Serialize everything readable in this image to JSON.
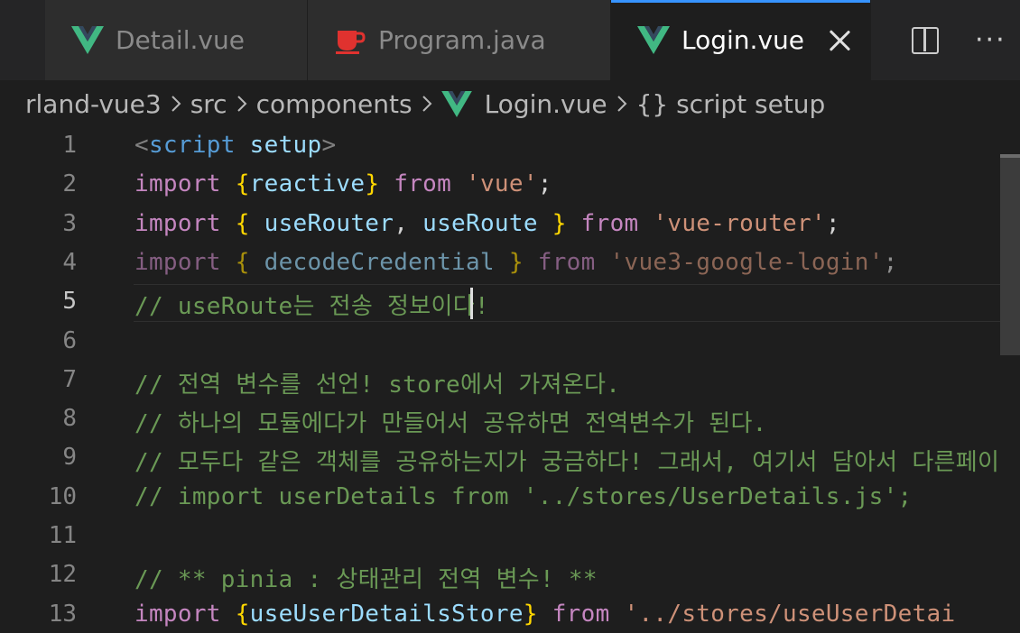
{
  "tabs": [
    {
      "label": "Detail.vue",
      "icon": "vue-icon",
      "active": false
    },
    {
      "label": "Program.java",
      "icon": "java-coffee-icon",
      "active": false
    },
    {
      "label": "Login.vue",
      "icon": "vue-icon",
      "active": true
    }
  ],
  "breadcrumb": {
    "items": [
      "rland-vue3",
      "src",
      "components",
      "Login.vue",
      "{} script setup"
    ]
  },
  "colors": {
    "vue_green": "#41b883",
    "vue_dark": "#34495e",
    "java_red": "#e0322f",
    "accent": "#3794ff"
  },
  "editor": {
    "current_line": 5,
    "lines": [
      {
        "no": "1",
        "tokens": [
          {
            "t": "<",
            "c": "t-punc"
          },
          {
            "t": "script",
            "c": "t-tag"
          },
          {
            "t": " ",
            "c": "t-plain"
          },
          {
            "t": "setup",
            "c": "t-attr"
          },
          {
            "t": ">",
            "c": "t-punc"
          }
        ]
      },
      {
        "no": "2",
        "tokens": [
          {
            "t": "import",
            "c": "t-kw"
          },
          {
            "t": " ",
            "c": "t-plain"
          },
          {
            "t": "{",
            "c": "t-brace"
          },
          {
            "t": "reactive",
            "c": "t-var"
          },
          {
            "t": "}",
            "c": "t-brace"
          },
          {
            "t": " from ",
            "c": "t-kw"
          },
          {
            "t": "'vue'",
            "c": "t-str"
          },
          {
            "t": ";",
            "c": "t-plain"
          }
        ]
      },
      {
        "no": "3",
        "tokens": [
          {
            "t": "import",
            "c": "t-kw"
          },
          {
            "t": " ",
            "c": "t-plain"
          },
          {
            "t": "{",
            "c": "t-brace"
          },
          {
            "t": " useRouter",
            "c": "t-var"
          },
          {
            "t": ",",
            "c": "t-plain"
          },
          {
            "t": " useRoute ",
            "c": "t-var"
          },
          {
            "t": "}",
            "c": "t-brace"
          },
          {
            "t": " from ",
            "c": "t-kw"
          },
          {
            "t": "'vue-router'",
            "c": "t-str"
          },
          {
            "t": ";",
            "c": "t-plain"
          }
        ]
      },
      {
        "no": "4",
        "dim": true,
        "tokens": [
          {
            "t": "import",
            "c": "t-kw"
          },
          {
            "t": " ",
            "c": "t-plain"
          },
          {
            "t": "{",
            "c": "t-brace"
          },
          {
            "t": " decodeCredential ",
            "c": "t-var"
          },
          {
            "t": "}",
            "c": "t-brace"
          },
          {
            "t": " from ",
            "c": "t-kw"
          },
          {
            "t": "'vue3-google-login'",
            "c": "t-str"
          },
          {
            "t": ";",
            "c": "t-plain"
          }
        ]
      },
      {
        "no": "5",
        "tokens": [
          {
            "t": "// useRoute는 전송 정보이다!",
            "c": "t-comment"
          }
        ]
      },
      {
        "no": "6",
        "tokens": []
      },
      {
        "no": "7",
        "tokens": [
          {
            "t": "// 전역 변수를 선언! store에서 가져온다.",
            "c": "t-comment"
          }
        ]
      },
      {
        "no": "8",
        "tokens": [
          {
            "t": "// 하나의 모듈에다가 만들어서 공유하면 전역변수가 된다.",
            "c": "t-comment"
          }
        ]
      },
      {
        "no": "9",
        "tokens": [
          {
            "t": "// 모두다 같은 객체를 공유하는지가 궁금하다! 그래서, 여기서 담아서 다른페이",
            "c": "t-comment"
          }
        ]
      },
      {
        "no": "10",
        "tokens": [
          {
            "t": "// import userDetails from '../stores/UserDetails.js';",
            "c": "t-comment"
          }
        ]
      },
      {
        "no": "11",
        "tokens": []
      },
      {
        "no": "12",
        "tokens": [
          {
            "t": "// ** pinia : 상태관리 전역 변수! **",
            "c": "t-comment"
          }
        ]
      },
      {
        "no": "13",
        "tokens": [
          {
            "t": "import",
            "c": "t-kw"
          },
          {
            "t": " ",
            "c": "t-plain"
          },
          {
            "t": "{",
            "c": "t-brace"
          },
          {
            "t": "useUserDetailsStore",
            "c": "t-var"
          },
          {
            "t": "}",
            "c": "t-brace"
          },
          {
            "t": " from ",
            "c": "t-kw"
          },
          {
            "t": "'../stores/useUserDetai",
            "c": "t-str"
          }
        ]
      }
    ]
  }
}
